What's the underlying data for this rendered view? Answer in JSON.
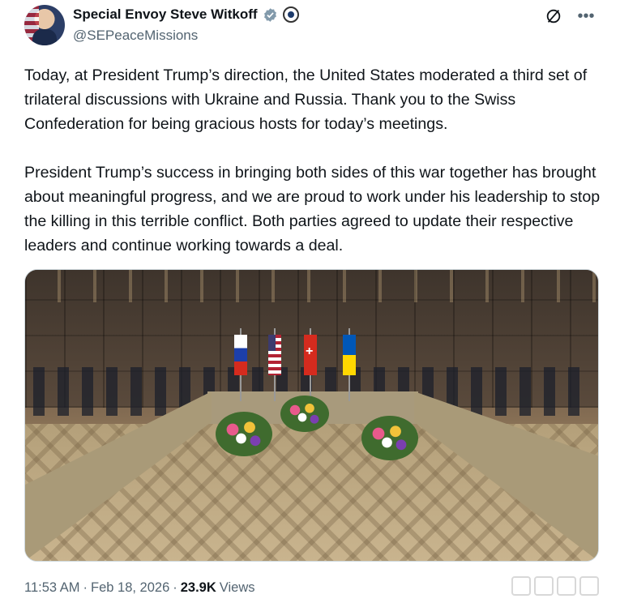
{
  "author": {
    "display_name": "Special Envoy Steve Witkoff",
    "handle": "@SEPeaceMissions",
    "badges": [
      "verified-icon",
      "state-department-seal-icon"
    ]
  },
  "header_actions": {
    "grok_icon": "slash-circle-icon",
    "more_icon": "more-horizontal-icon",
    "more_glyph": "•••"
  },
  "post": {
    "paragraph_1": "Today, at President Trump’s direction, the United States moderated a third set of trilateral discussions with Ukraine and Russia. Thank you to the Swiss Confederation for being gracious hosts for today’s meetings.",
    "paragraph_2": "President Trump’s success in bringing both sides of this war together has brought about meaningful progress, and we are proud to work under his leadership to stop the killing in this terrible conflict. Both parties agreed to update their respective leaders and continue working towards a deal."
  },
  "media": {
    "flags": [
      "russia-flag",
      "usa-flag",
      "switzerland-flag",
      "ukraine-flag"
    ]
  },
  "meta": {
    "time": "11:53 AM",
    "separator": "·",
    "date": "Feb 18, 2026",
    "views_count": "23.9K",
    "views_label": "Views"
  },
  "colors": {
    "text": "#0f1419",
    "secondary": "#536471",
    "verified": "#829aab"
  }
}
